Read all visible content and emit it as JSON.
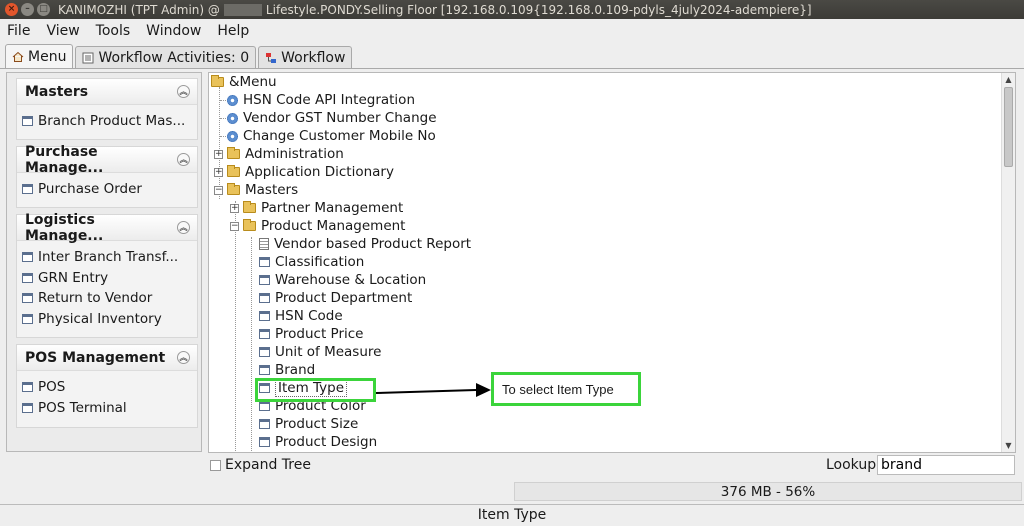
{
  "window": {
    "title_prefix": "KANIMOZHI (TPT Admin) @",
    "title_suffix": "Lifestyle.PONDY.Selling Floor [192.168.0.109{192.168.0.109-pdyls_4july2024-adempiere}]"
  },
  "menubar": [
    "File",
    "View",
    "Tools",
    "Window",
    "Help"
  ],
  "tabs": [
    {
      "label": "Menu",
      "icon": "home-icon"
    },
    {
      "label": "Workflow Activities: 0",
      "icon": "list-icon"
    },
    {
      "label": "Workflow",
      "icon": "workflow-icon"
    }
  ],
  "sidebar": {
    "panels": [
      {
        "title": "Masters",
        "items": [
          "Branch Product Mas..."
        ]
      },
      {
        "title": "Purchase Manage...",
        "items": [
          "Purchase Order"
        ]
      },
      {
        "title": "Logistics Manage...",
        "items": [
          "Inter Branch Transf...",
          "GRN Entry",
          "Return to Vendor",
          "Physical Inventory"
        ]
      },
      {
        "title": "POS Management",
        "items": [
          "POS",
          "POS Terminal"
        ]
      }
    ]
  },
  "tree": {
    "root": "&Menu",
    "nodes": [
      {
        "label": "HSN Code API Integration",
        "type": "process"
      },
      {
        "label": "Vendor GST Number Change",
        "type": "process"
      },
      {
        "label": "Change Customer Mobile No",
        "type": "process"
      },
      {
        "label": "Administration",
        "type": "folder"
      },
      {
        "label": "Application Dictionary",
        "type": "folder"
      },
      {
        "label": "Masters",
        "type": "folder"
      },
      {
        "label": "Partner Management",
        "type": "folder"
      },
      {
        "label": "Product Management",
        "type": "folder"
      },
      {
        "label": "Vendor based Product Report",
        "type": "report"
      },
      {
        "label": "Classification",
        "type": "window"
      },
      {
        "label": "Warehouse & Location",
        "type": "window"
      },
      {
        "label": "Product Department",
        "type": "window"
      },
      {
        "label": "HSN Code",
        "type": "window"
      },
      {
        "label": "Product Price",
        "type": "window"
      },
      {
        "label": "Unit of Measure",
        "type": "window"
      },
      {
        "label": "Brand",
        "type": "window"
      },
      {
        "label": "Item Type",
        "type": "window"
      },
      {
        "label": "Product Color",
        "type": "window"
      },
      {
        "label": "Product Size",
        "type": "window"
      },
      {
        "label": "Product Design",
        "type": "window"
      }
    ]
  },
  "annotation": {
    "text": "To select Item Type",
    "color": "#3bd43b"
  },
  "bottom": {
    "expand_tree": "Expand Tree",
    "lookup_label": "Lookup",
    "lookup_value": "brand"
  },
  "memory": "376 MB - 56%",
  "status": "Item Type"
}
